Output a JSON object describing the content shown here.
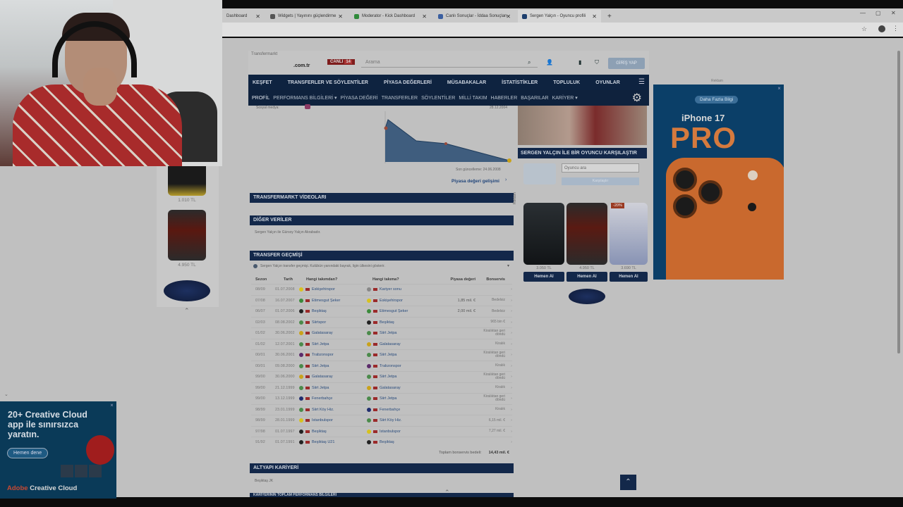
{
  "browser": {
    "tabs": [
      {
        "title": "Dashboard",
        "icon": "dashboard-tab-icon",
        "color": "#6c6c6c"
      },
      {
        "title": "Widgets | Yayınını güçlendirme",
        "icon": "widget-tab-icon",
        "color": "#555555"
      },
      {
        "title": "Moderator - Kick Dashboard",
        "icon": "kick-tab-icon",
        "color": "#2f8a3a"
      },
      {
        "title": "Canlı Sonuçlar - İddaa Sonuçları",
        "icon": "results-tab-icon",
        "color": "#3b5fa0"
      },
      {
        "title": "Sergen Yalçın - Oyuncu profili",
        "icon": "transfermarkt-tab-icon",
        "color": "#1d3f6e"
      }
    ]
  },
  "site": {
    "logo_text": "Transfermarkt",
    "tld": ".com.tr",
    "live_label": "CANLI",
    "live_count": "14",
    "search_placeholder": "Arama",
    "login_label": "GİRİŞ YAP",
    "main_nav": [
      "KEŞFET",
      "TRANSFERLER VE SÖYLENTİLER",
      "PİYASA DEĞERLERİ",
      "MÜSABAKALAR",
      "İSTATİSTİKLER",
      "TOPLULUK",
      "OYUNLAR"
    ],
    "sub_nav": [
      "PROFİL",
      "PERFORMANS BİLGİLERİ ▾",
      "PİYASA DEĞERİ",
      "TRANSFERLER",
      "SÖYLENTİLER",
      "MİLLİ TAKIM",
      "HABERLER",
      "BAŞARILAR",
      "KARİYER ▾"
    ]
  },
  "profile": {
    "social_label": "Sosyal medya:",
    "chart_date_top": "28.12.2004",
    "chart_updated": "Son güncelleme: 24.06.2008",
    "market_value_link": "Piyasa değeri gelişimi"
  },
  "sections": {
    "videos": "TRANSFERMARKT VİDEOLARI",
    "other": "DİĞER VERİLER",
    "other_text": "Sergen Yalçın ile Gürsoy Yalçın Akrabadır.",
    "history": "TRANSFER GEÇMİŞİ",
    "history_hint": "Sergen Yalçın transfer geçmişi. Kulübün yanındaki bayrak, ligin ülkesini gösterir.",
    "youth": "ALTYAPI KARİYERİ",
    "youth_text": "Beşiktaş JK",
    "bottom_partial": "KARİYERİNİN TOPLAM PERFORMANS BİLGİLERİ"
  },
  "transfer_table": {
    "headers": [
      "Sezon",
      "Tarih",
      "Hangi takımdan?",
      "Hangi takıma?",
      "Piyasa değeri",
      "Bonservis"
    ],
    "rows": [
      {
        "season": "08/09",
        "date": "01.07.2008",
        "from": "Eskişehirspor",
        "from_color": "#d8c21f",
        "to": "Kariyer sonu",
        "to_color": "#888888",
        "mv": "",
        "fee": ""
      },
      {
        "season": "07/08",
        "date": "16.07.2007",
        "from": "Etimesgut Şeker",
        "from_color": "#3a8a3a",
        "to": "Eskişehirspor",
        "to_color": "#d8c21f",
        "mv": "1,85 mil. €",
        "fee": "Bedelsiz"
      },
      {
        "season": "06/07",
        "date": "01.07.2006",
        "from": "Beşiktaş",
        "from_color": "#222222",
        "to": "Etimesgut Şeker",
        "to_color": "#3a8a3a",
        "mv": "2,00 mil. €",
        "fee": "Bedelsiz"
      },
      {
        "season": "02/03",
        "date": "08.08.2002",
        "from": "Siirtspor",
        "from_color": "#4a8a4a",
        "to": "Beşiktaş",
        "to_color": "#222222",
        "mv": "",
        "fee": "965 bin €"
      },
      {
        "season": "01/02",
        "date": "30.06.2002",
        "from": "Galatasaray",
        "from_color": "#c9a21a",
        "to": "Siirt Jetpa",
        "to_color": "#4a8a4a",
        "mv": "",
        "fee": "Kiralıktan geri döndü"
      },
      {
        "season": "01/02",
        "date": "12.07.2001",
        "from": "Siirt Jetpa",
        "from_color": "#4a8a4a",
        "to": "Galatasaray",
        "to_color": "#c9a21a",
        "mv": "",
        "fee": "Kiralık"
      },
      {
        "season": "00/01",
        "date": "30.06.2001",
        "from": "Trabzonspor",
        "from_color": "#5b2a6a",
        "to": "Siirt Jetpa",
        "to_color": "#4a8a4a",
        "mv": "",
        "fee": "Kiralıktan geri döndü"
      },
      {
        "season": "00/01",
        "date": "09.08.2000",
        "from": "Siirt Jetpa",
        "from_color": "#4a8a4a",
        "to": "Trabzonspor",
        "to_color": "#5b2a6a",
        "mv": "",
        "fee": "Kiralık"
      },
      {
        "season": "99/00",
        "date": "30.06.2000",
        "from": "Galatasaray",
        "from_color": "#c9a21a",
        "to": "Siirt Jetpa",
        "to_color": "#4a8a4a",
        "mv": "",
        "fee": "Kiralıktan geri döndü"
      },
      {
        "season": "99/00",
        "date": "21.12.1999",
        "from": "Siirt Jetpa",
        "from_color": "#4a8a4a",
        "to": "Galatasaray",
        "to_color": "#c9a21a",
        "mv": "",
        "fee": "Kiralık"
      },
      {
        "season": "99/00",
        "date": "13.12.1999",
        "from": "Fenerbahçe",
        "from_color": "#1f2d6e",
        "to": "Siirt Jetpa",
        "to_color": "#4a8a4a",
        "mv": "",
        "fee": "Kiralıktan geri döndü"
      },
      {
        "season": "98/99",
        "date": "23.01.1999",
        "from": "Siirt Köy Hiz.",
        "from_color": "#4a8a4a",
        "to": "Fenerbahçe",
        "to_color": "#1f2d6e",
        "mv": "",
        "fee": "Kiralık"
      },
      {
        "season": "98/99",
        "date": "28.01.1999",
        "from": "İstanbulspor",
        "from_color": "#d6c21e",
        "to": "Siirt Köy Hiz.",
        "to_color": "#4a8a4a",
        "mv": "",
        "fee": "6,15 mil. €"
      },
      {
        "season": "97/98",
        "date": "01.07.1997",
        "from": "Beşiktaş",
        "from_color": "#222222",
        "to": "İstanbulspor",
        "to_color": "#d6c21e",
        "mv": "",
        "fee": "7,27 mil. €"
      },
      {
        "season": "91/92",
        "date": "01.07.1991",
        "from": "Beşiktaş U21",
        "from_color": "#222222",
        "to": "Beşiktaş",
        "to_color": "#222222",
        "mv": "",
        "fee": ""
      }
    ],
    "total_label": "Toplam bonservis bedeli:",
    "total_value": "14,43 mil. €"
  },
  "right_column": {
    "compare_title": "SERGEN YALÇIN İLE BİR OYUNCU KARŞILAŞTIR",
    "compare_placeholder": "Oyuncu ara",
    "compare_button": "Karşılaştır",
    "ad_tag": "Reklam",
    "products": [
      {
        "name": "Animal Creatine",
        "price": "3.050 TL",
        "buy": "Hemen Al",
        "color": "#2a2f33"
      },
      {
        "name": "Primal",
        "price": "4.950 TL",
        "buy": "Hemen Al",
        "color": "#5a1a12"
      },
      {
        "name": "Whey Aminos",
        "price": "3.690 TL",
        "buy": "Hemen Al",
        "color": "#e8e8f0",
        "badge": "-20%"
      }
    ]
  },
  "ad_iphone": {
    "tag": "Reklam",
    "pill": "Daha Fazla Bilgi",
    "line1": "iPhone 17",
    "line2": "PRO"
  },
  "left_column": {
    "products": [
      {
        "name": "Opti-Men",
        "price": "1.010 TL",
        "color": "#1a1a1a"
      },
      {
        "name": "Primal",
        "price": "4.950 TL",
        "color": "#4c1610"
      }
    ],
    "logo_text": "SUPPLEMENTLER"
  },
  "ad_adobe": {
    "headline": "20+ Creative Cloud app ile sınırsızca yaratın.",
    "button": "Hemen dene",
    "brand_prefix": "Adobe",
    "brand_suffix": "Creative Cloud"
  }
}
